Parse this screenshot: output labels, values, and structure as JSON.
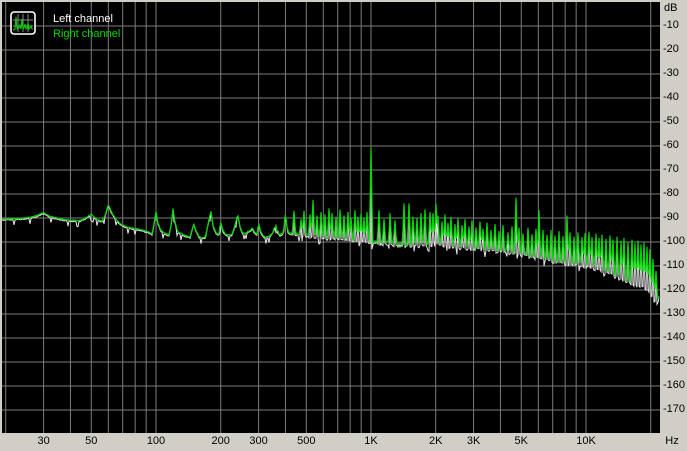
{
  "window": {
    "background": "#d1cec7",
    "plot_background": "#000000",
    "grid_color": "#7b7b7b"
  },
  "legend": {
    "items": [
      {
        "label": "Left channel",
        "color": "#ffffff"
      },
      {
        "label": "Right channel",
        "color": "#00d800"
      }
    ]
  },
  "chart_data": {
    "type": "line",
    "x_axis": {
      "unit": "Hz",
      "scale": "log",
      "range_hz": [
        18.8,
        21900
      ],
      "tick_labels": [
        "30",
        "50",
        "100",
        "200",
        "300",
        "500",
        "1K",
        "2K",
        "3K",
        "5K",
        "10K"
      ],
      "tick_freqs": [
        30,
        50,
        100,
        200,
        300,
        500,
        1000,
        2000,
        3000,
        5000,
        10000
      ],
      "gridline_freqs": [
        20,
        30,
        40,
        50,
        60,
        70,
        80,
        90,
        100,
        200,
        300,
        400,
        500,
        600,
        700,
        800,
        900,
        1000,
        2000,
        3000,
        4000,
        5000,
        6000,
        7000,
        8000,
        9000,
        10000,
        20000
      ]
    },
    "y_axis": {
      "unit": "dB",
      "range_db": [
        0,
        -180
      ],
      "tick_labels": [
        "-10",
        "-20",
        "-30",
        "-40",
        "-50",
        "-60",
        "-70",
        "-80",
        "-90",
        "-100",
        "-110",
        "-120",
        "-130",
        "-140",
        "-150",
        "-160",
        "-170"
      ],
      "tick_values": [
        -10,
        -20,
        -30,
        -40,
        -50,
        -60,
        -70,
        -80,
        -90,
        -100,
        -110,
        -120,
        -130,
        -140,
        -150,
        -160,
        -170
      ]
    },
    "series": [
      {
        "name": "Left channel",
        "color": "#e6e6e6"
      },
      {
        "name": "Right channel",
        "color": "#00d800"
      }
    ],
    "spectrum": {
      "comment_noise_floor": "piecewise envelope [freq_hz, dB] incl. broad 50/60Hz-harmonic humps",
      "noise_floor": [
        [
          18.8,
          -90.4
        ],
        [
          22,
          -90.3
        ],
        [
          26,
          -89.8
        ],
        [
          28,
          -88.9
        ],
        [
          30,
          -87.7
        ],
        [
          32,
          -89.3
        ],
        [
          36,
          -90.4
        ],
        [
          40,
          -90.9
        ],
        [
          44,
          -91
        ],
        [
          47,
          -90
        ],
        [
          50,
          -88.4
        ],
        [
          53,
          -90.5
        ],
        [
          56,
          -91.4
        ],
        [
          58,
          -89
        ],
        [
          60,
          -84.3
        ],
        [
          62,
          -87.5
        ],
        [
          65,
          -90.5
        ],
        [
          69,
          -92.8
        ],
        [
          74,
          -93.8
        ],
        [
          80,
          -94.4
        ],
        [
          86,
          -94.9
        ],
        [
          92,
          -95.8
        ],
        [
          96,
          -96.7
        ],
        [
          98,
          -92
        ],
        [
          100,
          -87.3
        ],
        [
          102,
          -92
        ],
        [
          105,
          -95
        ],
        [
          110,
          -96.4
        ],
        [
          115,
          -97
        ],
        [
          118,
          -92
        ],
        [
          120,
          -85.9
        ],
        [
          122,
          -91
        ],
        [
          126,
          -95.6
        ],
        [
          132,
          -96.7
        ],
        [
          138,
          -97.4
        ],
        [
          144,
          -97.9
        ],
        [
          148,
          -94
        ],
        [
          150,
          -92.3
        ],
        [
          153,
          -95
        ],
        [
          158,
          -97.6
        ],
        [
          164,
          -98.3
        ],
        [
          170,
          -97.8
        ],
        [
          174,
          -93
        ],
        [
          180,
          -87
        ],
        [
          184,
          -93
        ],
        [
          190,
          -96.2
        ],
        [
          196,
          -97
        ],
        [
          200,
          -91.3
        ],
        [
          204,
          -95
        ],
        [
          210,
          -96.7
        ],
        [
          218,
          -97.1
        ],
        [
          226,
          -96.8
        ],
        [
          233,
          -93
        ],
        [
          240,
          -88.5
        ],
        [
          246,
          -93.5
        ],
        [
          252,
          -96.1
        ],
        [
          260,
          -96.5
        ],
        [
          268,
          -95.6
        ],
        [
          276,
          -95
        ],
        [
          280,
          -94
        ],
        [
          286,
          -95.8
        ],
        [
          295,
          -96.8
        ],
        [
          300,
          -92.1
        ],
        [
          306,
          -95.5
        ],
        [
          315,
          -97.4
        ],
        [
          325,
          -98.1
        ],
        [
          335,
          -97.6
        ],
        [
          345,
          -96.7
        ],
        [
          355,
          -94.5
        ],
        [
          360,
          -92.4
        ],
        [
          366,
          -95
        ],
        [
          375,
          -96.6
        ],
        [
          385,
          -97.1
        ],
        [
          395,
          -94
        ],
        [
          400,
          -86.7
        ],
        [
          405,
          -93
        ],
        [
          412,
          -95.8
        ],
        [
          422,
          -96.2
        ],
        [
          435,
          -96.4
        ],
        [
          450,
          -96.7
        ],
        [
          465,
          -97
        ],
        [
          480,
          -96.7
        ],
        [
          495,
          -96.9
        ],
        [
          510,
          -97.3
        ],
        [
          525,
          -97.6
        ],
        [
          540,
          -97.2
        ],
        [
          560,
          -97.7
        ],
        [
          580,
          -97.9
        ],
        [
          600,
          -98.1
        ],
        [
          630,
          -98.3
        ],
        [
          660,
          -98.5
        ],
        [
          700,
          -98.3
        ],
        [
          740,
          -98.7
        ],
        [
          780,
          -98.9
        ],
        [
          820,
          -99.1
        ],
        [
          860,
          -99.3
        ],
        [
          900,
          -99.4
        ],
        [
          950,
          -99.6
        ],
        [
          1000,
          -99.8
        ],
        [
          1100,
          -100.2
        ],
        [
          1200,
          -100.4
        ],
        [
          1350,
          -100.7
        ],
        [
          1500,
          -100.9
        ],
        [
          1700,
          -101
        ],
        [
          1900,
          -100.8
        ],
        [
          2000,
          -100.4
        ],
        [
          2200,
          -101.2
        ],
        [
          2500,
          -101.7
        ],
        [
          2800,
          -102.1
        ],
        [
          3100,
          -102.4
        ],
        [
          3500,
          -102.8
        ],
        [
          4000,
          -103.4
        ],
        [
          4500,
          -104.1
        ],
        [
          5000,
          -104.9
        ],
        [
          5500,
          -105.7
        ],
        [
          6000,
          -106.4
        ],
        [
          6600,
          -107.2
        ],
        [
          7200,
          -107.9
        ],
        [
          8000,
          -108.3
        ],
        [
          8800,
          -108.8
        ],
        [
          9600,
          -109.4
        ],
        [
          10500,
          -110.2
        ],
        [
          11500,
          -111.3
        ],
        [
          12500,
          -112.4
        ],
        [
          13500,
          -113.6
        ],
        [
          14800,
          -115
        ],
        [
          16000,
          -116.4
        ],
        [
          17500,
          -117.8
        ],
        [
          18800,
          -119
        ],
        [
          19600,
          -120
        ],
        [
          20100,
          -121.5
        ],
        [
          20600,
          -123.5
        ],
        [
          21000,
          -124.8
        ],
        [
          21400,
          -125.3
        ],
        [
          21900,
          -122.5
        ]
      ],
      "comment_spikes": "narrow harmonic spikes [freq_hz, peak_dB]; dominant tone 1 kHz at -61 dB",
      "spikes": [
        [
          440,
          -87
        ],
        [
          470,
          -90.5
        ],
        [
          490,
          -87
        ],
        [
          520,
          -88.5
        ],
        [
          537,
          -82.5
        ],
        [
          560,
          -89
        ],
        [
          585,
          -87.5
        ],
        [
          610,
          -88.5
        ],
        [
          640,
          -86
        ],
        [
          660,
          -88
        ],
        [
          690,
          -89.5
        ],
        [
          720,
          -86.5
        ],
        [
          750,
          -89
        ],
        [
          780,
          -87.5
        ],
        [
          810,
          -89.8
        ],
        [
          840,
          -86.8
        ],
        [
          870,
          -89.5
        ],
        [
          900,
          -88
        ],
        [
          930,
          -90
        ],
        [
          960,
          -87.5
        ],
        [
          1000,
          -60.8
        ],
        [
          1090,
          -86.7
        ],
        [
          1150,
          -90.5
        ],
        [
          1230,
          -88
        ],
        [
          1300,
          -91
        ],
        [
          1420,
          -83.9
        ],
        [
          1500,
          -83.9
        ],
        [
          1570,
          -89.5
        ],
        [
          1640,
          -90
        ],
        [
          1710,
          -88
        ],
        [
          1780,
          -86.4
        ],
        [
          1880,
          -87.5
        ],
        [
          1940,
          -88
        ],
        [
          2000,
          -84
        ],
        [
          2060,
          -89
        ],
        [
          2130,
          -91.5
        ],
        [
          2200,
          -88.5
        ],
        [
          2280,
          -92
        ],
        [
          2360,
          -89.5
        ],
        [
          2450,
          -92.5
        ],
        [
          2540,
          -90
        ],
        [
          2640,
          -93
        ],
        [
          2740,
          -90.5
        ],
        [
          2850,
          -93.5
        ],
        [
          2960,
          -91
        ],
        [
          3080,
          -94
        ],
        [
          3200,
          -91.5
        ],
        [
          3330,
          -94.5
        ],
        [
          3470,
          -92
        ],
        [
          3620,
          -95
        ],
        [
          3780,
          -92.5
        ],
        [
          3950,
          -95.5
        ],
        [
          4130,
          -93
        ],
        [
          4320,
          -96
        ],
        [
          4520,
          -93.5
        ],
        [
          4700,
          -81.5
        ],
        [
          4900,
          -94
        ],
        [
          5120,
          -96.5
        ],
        [
          5350,
          -94
        ],
        [
          5600,
          -96.8
        ],
        [
          5850,
          -94.5
        ],
        [
          6040,
          -86.7
        ],
        [
          6300,
          -95
        ],
        [
          6580,
          -97
        ],
        [
          6870,
          -95
        ],
        [
          7170,
          -97.3
        ],
        [
          7480,
          -95.5
        ],
        [
          7800,
          -97.6
        ],
        [
          8130,
          -89
        ],
        [
          8470,
          -96
        ],
        [
          8820,
          -97.8
        ],
        [
          9180,
          -96
        ],
        [
          9550,
          -98
        ],
        [
          9930,
          -96.3
        ],
        [
          10300,
          -95.7
        ],
        [
          10700,
          -98
        ],
        [
          11100,
          -96.5
        ],
        [
          11500,
          -98.3
        ],
        [
          11900,
          -97
        ],
        [
          12400,
          -98.6
        ],
        [
          12900,
          -97.3
        ],
        [
          13400,
          -99
        ],
        [
          13900,
          -97.8
        ],
        [
          14500,
          -99.5
        ],
        [
          15100,
          -98.3
        ],
        [
          15700,
          -100
        ],
        [
          16300,
          -99
        ],
        [
          16900,
          -100.5
        ],
        [
          17500,
          -99.5
        ],
        [
          18100,
          -101
        ],
        [
          18700,
          -100.3
        ],
        [
          19300,
          -102
        ],
        [
          19900,
          -103
        ],
        [
          20500,
          -107
        ],
        [
          21100,
          -112
        ]
      ]
    }
  }
}
